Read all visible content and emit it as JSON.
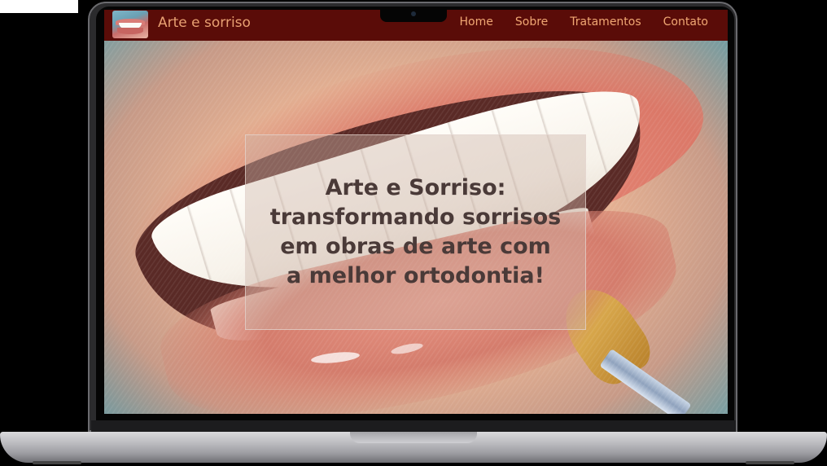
{
  "site": {
    "brand": "Arte e sorriso",
    "nav": [
      {
        "label": "Home"
      },
      {
        "label": "Sobre"
      },
      {
        "label": "Tratamentos"
      },
      {
        "label": "Contato"
      }
    ]
  },
  "hero": {
    "title": "Arte e Sorriso: transformando sorrisos em obras de arte com a melhor ortodontia!"
  },
  "colors": {
    "navbar_bg": "#5a0c08",
    "nav_text": "#f0a773",
    "hero_title": "#4a3a38"
  },
  "icons": {
    "logo": "smile-logo-icon",
    "camera": "camera-icon"
  }
}
